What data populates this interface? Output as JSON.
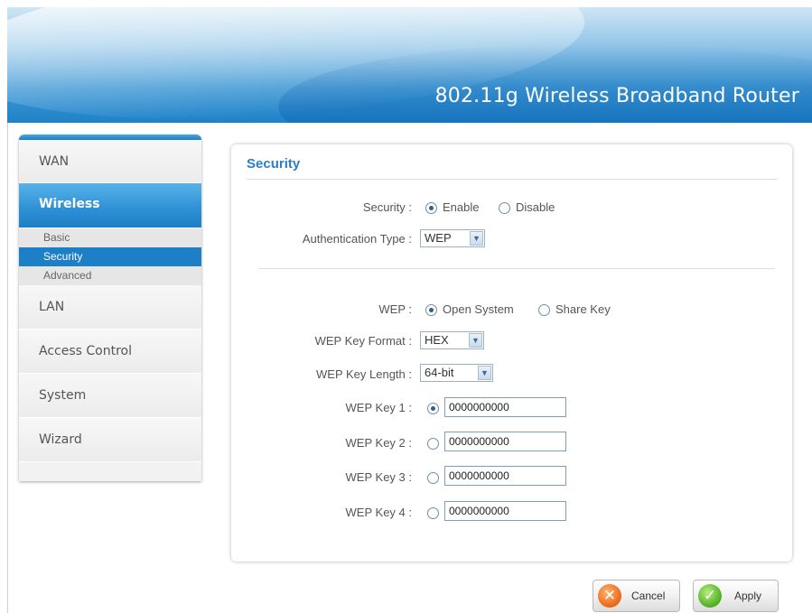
{
  "header": {
    "title": "802.11g Wireless Broadband Router"
  },
  "sidebar": {
    "items": [
      {
        "label": "WAN"
      },
      {
        "label": "Wireless"
      },
      {
        "label": "LAN"
      },
      {
        "label": "Access Control"
      },
      {
        "label": "System"
      },
      {
        "label": "Wizard"
      }
    ],
    "wireless_sub": [
      "Basic",
      "Security",
      "Advanced"
    ]
  },
  "panel": {
    "title": "Security",
    "security": {
      "label": "Security :",
      "options": [
        "Enable",
        "Disable"
      ],
      "selected": "Enable"
    },
    "auth_type": {
      "label": "Authentication Type :",
      "value": "WEP"
    },
    "wep": {
      "label": "WEP :",
      "options": [
        "Open System",
        "Share Key"
      ],
      "selected": "Open System"
    },
    "key_format": {
      "label": "WEP Key Format :",
      "value": "HEX"
    },
    "key_length": {
      "label": "WEP Key Length :",
      "value": "64-bit"
    },
    "keys": [
      {
        "label": "WEP Key 1 :",
        "value": "0000000000",
        "selected": true
      },
      {
        "label": "WEP Key 2 :",
        "value": "0000000000",
        "selected": false
      },
      {
        "label": "WEP Key 3 :",
        "value": "0000000000",
        "selected": false
      },
      {
        "label": "WEP Key 4 :",
        "value": "0000000000",
        "selected": false
      }
    ]
  },
  "buttons": {
    "cancel": "Cancel",
    "apply": "Apply"
  },
  "colors": {
    "accent": "#2a7fc4",
    "header_blue": "#1f82c8",
    "active_sub": "#1d80c7"
  }
}
